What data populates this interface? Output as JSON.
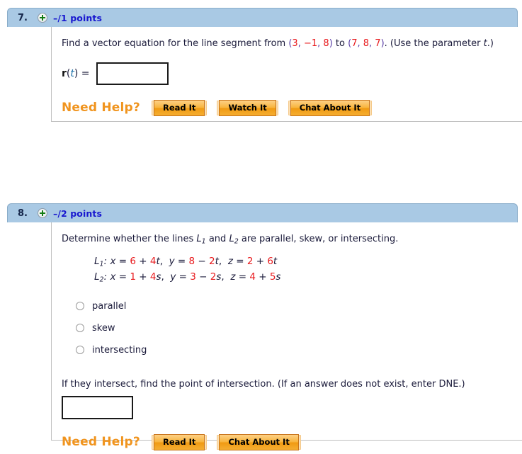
{
  "questions": [
    {
      "number": "7.",
      "points": "–/1 points",
      "expand_icon": "plus-circle-icon",
      "prompt": {
        "part1": "Find a vector equation for the line segment from",
        "point_a": {
          "open": "(",
          "x": "3",
          "sep1": ", ",
          "y": "−1",
          "sep2": ", ",
          "z": "8",
          "close": ")"
        },
        "connector": "to",
        "point_b": {
          "open": "(",
          "x": "7",
          "sep1": ", ",
          "y": "8",
          "sep2": ", ",
          "z": "7",
          "close": ")"
        },
        "part2": ".  (Use the parameter",
        "param": "t",
        "part3": ".)"
      },
      "answer_label": {
        "vector": "r",
        "open": "(",
        "param": "t",
        "close": ")",
        "equals": "="
      },
      "answer_value": "",
      "need_help": {
        "label": "Need Help?",
        "buttons": [
          "Read It",
          "Watch It",
          "Chat About It"
        ]
      }
    },
    {
      "number": "8.",
      "points": "–/2 points",
      "expand_icon": "plus-circle-icon",
      "prompt": {
        "part1": "Determine whether the lines",
        "line1_name": "L",
        "line1_sub": "1",
        "connector": "and",
        "line2_name": "L",
        "line2_sub": "2",
        "part2": "are parallel, skew, or intersecting."
      },
      "lines": [
        {
          "name": "L",
          "sub": "1",
          "colon": ":",
          "eq_x": {
            "var": "x",
            "eq": "=",
            "c": "6",
            "op": "+",
            "m": "4",
            "param": "t"
          },
          "eq_y": {
            "var": "y",
            "eq": "=",
            "c": "8",
            "op": "−",
            "m": "2",
            "param": "t"
          },
          "eq_z": {
            "var": "z",
            "eq": "=",
            "c": "2",
            "op": "+",
            "m": "6",
            "param": "t"
          }
        },
        {
          "name": "L",
          "sub": "2",
          "colon": ":",
          "eq_x": {
            "var": "x",
            "eq": "=",
            "c": "1",
            "op": "+",
            "m": "4",
            "param": "s"
          },
          "eq_y": {
            "var": "y",
            "eq": "=",
            "c": "3",
            "op": "−",
            "m": "2",
            "param": "s"
          },
          "eq_z": {
            "var": "z",
            "eq": "=",
            "c": "4",
            "op": "+",
            "m": "5",
            "param": "s"
          }
        }
      ],
      "options": [
        {
          "label": "parallel",
          "selected": false
        },
        {
          "label": "skew",
          "selected": false
        },
        {
          "label": "intersecting",
          "selected": false
        }
      ],
      "followup": "If they intersect, find the point of intersection. (If an answer does not exist, enter DNE.)",
      "followup_value": "",
      "need_help": {
        "label": "Need Help?",
        "buttons": [
          "Read It",
          "Chat About It"
        ]
      }
    }
  ],
  "colors": {
    "header_bg": "#a9c9e4",
    "points_text": "#1818cf",
    "number_red": "#e8191c",
    "need_help_orange": "#f0941e",
    "button_orange": "#f5a623"
  }
}
